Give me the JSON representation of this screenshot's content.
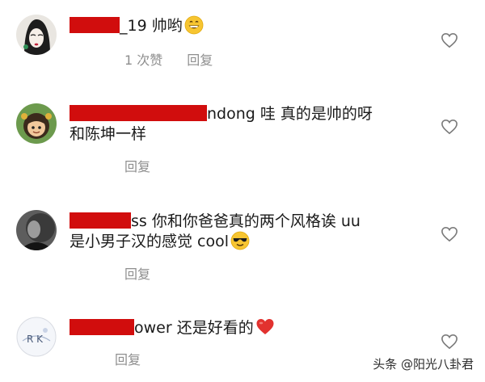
{
  "comments": [
    {
      "username_visible": "_19",
      "text": " 帅哟",
      "emoji": "grinning-face",
      "likes_label": "1 次赞",
      "reply_label": "回复",
      "heart_icon": "heart-outline-icon"
    },
    {
      "username_visible": "ndong",
      "text_line1": " 哇  真的是帅的呀",
      "text_line2": "和陈坤一样",
      "reply_label": "回复",
      "heart_icon": "heart-outline-icon"
    },
    {
      "username_visible": "ss",
      "text_line1": " 你和你爸爸真的两个风格诶 uu",
      "text_line2": "是小男子汉的感觉 cool",
      "emoji": "sunglasses-face",
      "reply_label": "回复",
      "heart_icon": "heart-outline-icon"
    },
    {
      "username_visible": "ower",
      "text": " 还是好看的",
      "emoji": "red-heart",
      "reply_label": "回复",
      "heart_icon": "heart-outline-icon"
    }
  ],
  "watermark": "头条 @阳光八卦君",
  "colors": {
    "redaction": "#d10d0d",
    "meta_text": "#8e8e8e"
  }
}
